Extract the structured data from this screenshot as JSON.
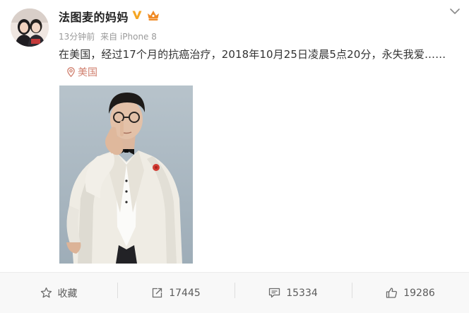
{
  "post": {
    "author": "法图麦的妈妈",
    "time": "13分钟前",
    "source": "来自 iPhone 8",
    "text": "在美国，经过17个月的抗癌治疗，2018年10月25日凌晨5点20分，永失我爱……",
    "location": "美国",
    "badges": [
      "verified-v-icon",
      "crown-member-icon"
    ],
    "colors": {
      "verified": "#f5a623",
      "crown": "#f08a24",
      "location": "#d07f6e"
    }
  },
  "toolbar": {
    "favorite_label": "收藏",
    "repost_count": "17445",
    "comment_count": "15334",
    "like_count": "19286"
  }
}
